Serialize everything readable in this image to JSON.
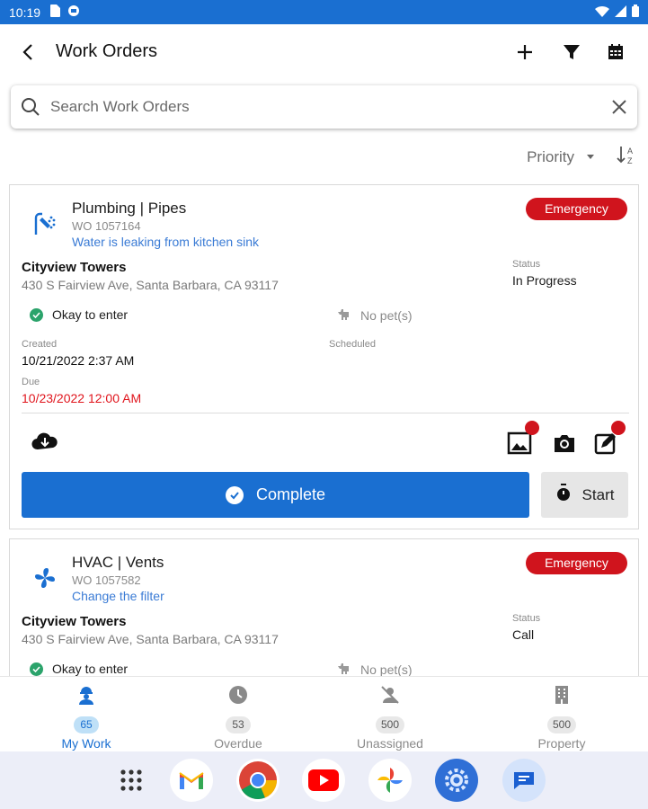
{
  "status_bar": {
    "time": "10:19"
  },
  "header": {
    "title": "Work Orders"
  },
  "search": {
    "placeholder": "Search Work Orders"
  },
  "sort": {
    "label": "Priority"
  },
  "work_orders": [
    {
      "category": "Plumbing | Pipes",
      "wo_number": "WO 1057164",
      "description": "Water is leaking from kitchen sink",
      "priority": "Emergency",
      "property_name": "Cityview Towers",
      "address": "430 S Fairview Ave, Santa Barbara, CA 93117",
      "status_label": "Status",
      "status": "In Progress",
      "entry": "Okay to enter",
      "pets": "No pet(s)",
      "created_label": "Created",
      "created": "10/21/2022 2:37 AM",
      "scheduled_label": "Scheduled",
      "due_label": "Due",
      "due": "10/23/2022 12:00 AM",
      "complete_label": "Complete",
      "start_label": "Start"
    },
    {
      "category": "HVAC | Vents",
      "wo_number": "WO 1057582",
      "description": "Change the filter",
      "priority": "Emergency",
      "property_name": "Cityview Towers",
      "address": "430 S Fairview Ave, Santa Barbara, CA 93117",
      "status_label": "Status",
      "status": "Call",
      "entry": "Okay to enter",
      "pets": "No pet(s)"
    }
  ],
  "tabs": [
    {
      "label": "My Work",
      "count": "65",
      "icon": "worker-icon",
      "active": true
    },
    {
      "label": "Overdue",
      "count": "53",
      "icon": "clock-icon",
      "active": false
    },
    {
      "label": "Unassigned",
      "count": "500",
      "icon": "person-off-icon",
      "active": false
    },
    {
      "label": "Property",
      "count": "500",
      "icon": "building-icon",
      "active": false
    }
  ],
  "dock_apps": [
    "app-drawer-icon",
    "gmail-icon",
    "chrome-icon",
    "youtube-icon",
    "photos-icon",
    "settings-icon",
    "messages-icon"
  ],
  "colors": {
    "primary": "#1a6fd1",
    "emergency": "#d0141d",
    "due": "#e0141c",
    "ok": "#2ba36b"
  }
}
